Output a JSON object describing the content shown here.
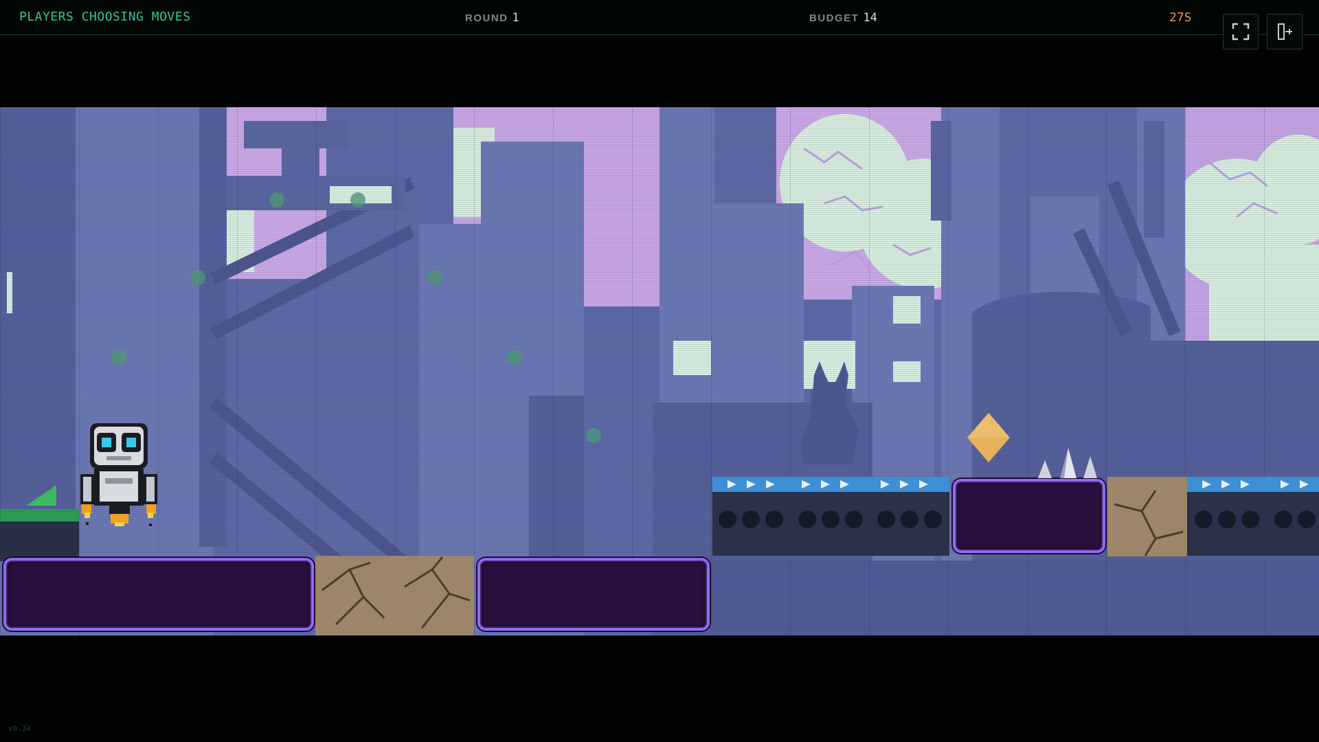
{
  "hud": {
    "status": "PLAYERS CHOOSING MOVES",
    "round_label": "ROUND",
    "round_value": "1",
    "budget_label": "BUDGET",
    "budget_value": "14",
    "timer": "27S"
  },
  "controls": {
    "fullscreen_icon": "fullscreen-icon",
    "exit_icon": "exit-door-icon"
  },
  "game": {
    "player": "robot-jetpack",
    "collectible": "diamond-gem",
    "hazard": "spikes",
    "conveyor_direction": "right"
  },
  "colors": {
    "status": "#2ec6a4",
    "timer": "#e6993a",
    "platform_border": "#8f6cf0",
    "platform_fill": "#28113e",
    "conveyor_belt": "#3d8fd6",
    "gem": "#e5b25a",
    "robot_eye": "#38c8e8"
  },
  "version": "v0.34"
}
